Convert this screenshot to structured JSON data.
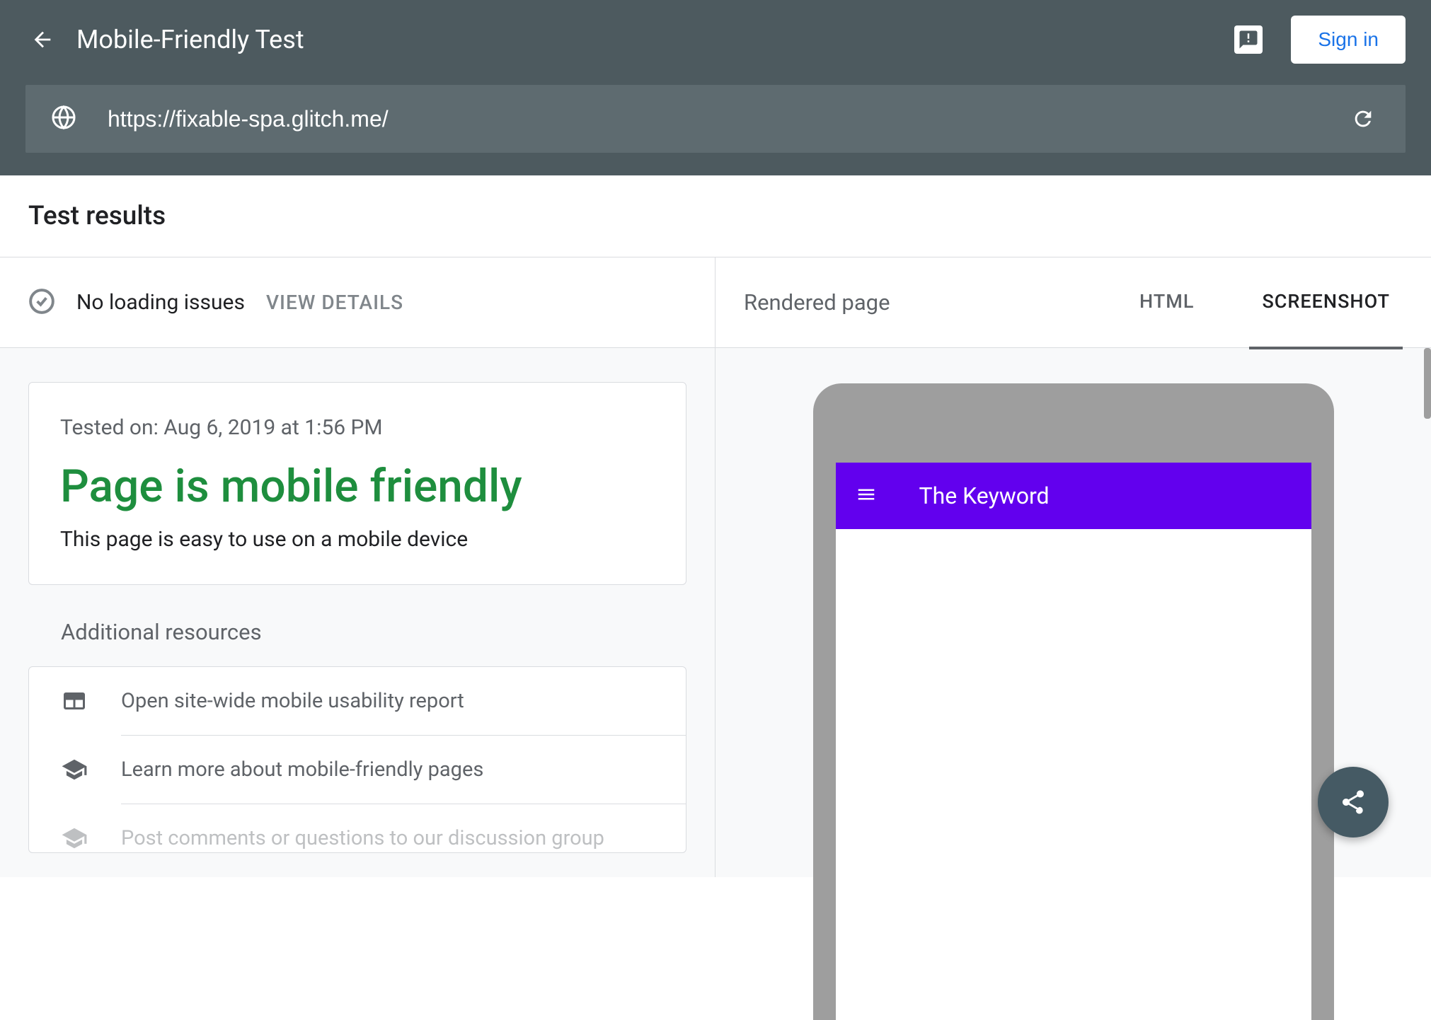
{
  "header": {
    "title": "Mobile-Friendly Test",
    "signin": "Sign in"
  },
  "url": "https://fixable-spa.glitch.me/",
  "results": {
    "section_title": "Test results",
    "status": "No loading issues",
    "view_details": "VIEW DETAILS",
    "tested_on": "Tested on: Aug 6, 2019 at 1:56 PM",
    "headline": "Page is mobile friendly",
    "subtext": "This page is easy to use on a mobile device"
  },
  "additional": {
    "title": "Additional resources",
    "items": [
      {
        "label": "Open site-wide mobile usability report"
      },
      {
        "label": "Learn more about mobile-friendly pages"
      },
      {
        "label": "Post comments or questions to our discussion group"
      }
    ]
  },
  "preview": {
    "rendered_label": "Rendered page",
    "tabs": {
      "html": "HTML",
      "screenshot": "SCREENSHOT"
    },
    "phone": {
      "title": "The Keyword"
    }
  }
}
